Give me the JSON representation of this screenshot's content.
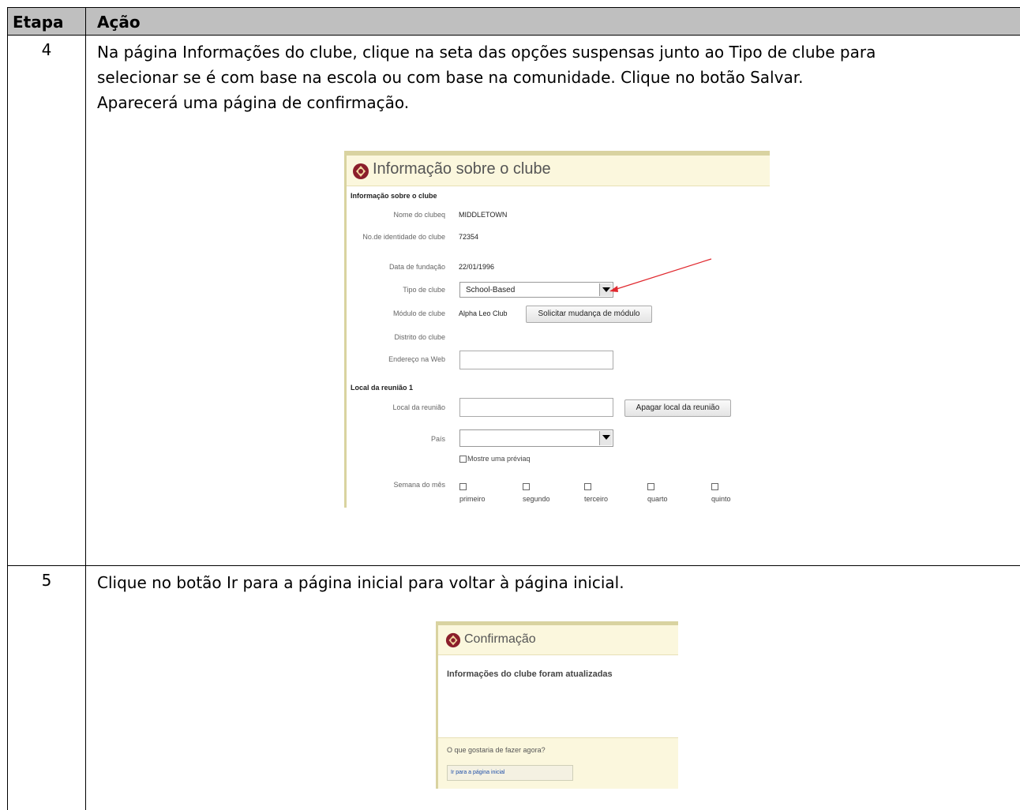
{
  "table": {
    "headers": {
      "step": "Etapa",
      "action": "Ação"
    },
    "rows": [
      {
        "step": "4",
        "text": "Na página Informações do clube, clique na seta das opções suspensas junto ao Tipo de clube para\nselecionar se é com base na escola ou com base na comunidade. Clique no botão Salvar.\nAparecerá uma página de confirmação."
      },
      {
        "step": "5",
        "text": "Clique no botão Ir para a página inicial para voltar à página inicial."
      }
    ]
  },
  "screenshot1": {
    "title": "Informação sobre o clube",
    "section": "Informação sobre o clube",
    "fields": {
      "club_name_label": "Nome do clubeq",
      "club_name_value": "MIDDLETOWN",
      "club_id_label": "No.de identidade do clube",
      "club_id_value": "72354",
      "founded_label": "Data de fundação",
      "founded_value": "22/01/1996",
      "type_label": "Tipo de clube",
      "type_value": "School-Based",
      "module_label": "Módulo de clube",
      "module_value": "Alpha Leo Club",
      "module_button": "Solicitar mudança de módulo",
      "district_label": "Distrito do clube",
      "web_label": "Endereço na Web"
    },
    "meeting_section": "Local da reunião 1",
    "meeting": {
      "place_label": "Local da reunião",
      "delete_button": "Apagar local da reunião",
      "country_label": "País",
      "preview_label": "Mostre uma préviaq",
      "week_label": "Semana do mês",
      "weeks": [
        "primeiro",
        "segundo",
        "terceiro",
        "quarto",
        "quinto"
      ]
    },
    "arrow_color": "#e0282e"
  },
  "screenshot2": {
    "title": "Confirmação",
    "message": "Informações do clube foram atualizadas",
    "question": "O que gostaria de fazer agora?",
    "home_link": "Ir para a página inicial"
  },
  "colors": {
    "header_bg": "#bfbfbf",
    "panel_bg": "#fbf7dd",
    "panel_border": "#d9d3a0",
    "link": "#1f4fa8"
  }
}
